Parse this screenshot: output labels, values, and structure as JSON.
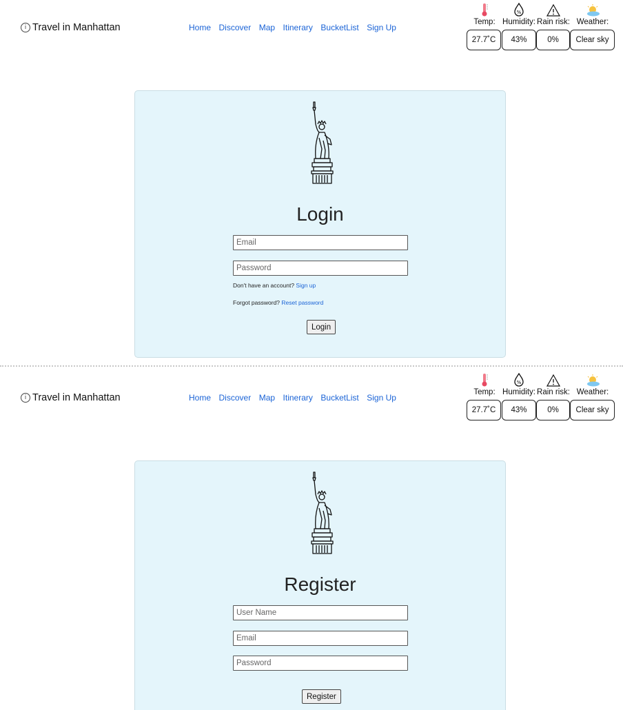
{
  "brand": {
    "icon": "info-icon",
    "text": "Travel in Manhattan",
    "glyph": "i"
  },
  "nav": [
    "Home",
    "Discover",
    "Map",
    "Itinerary",
    "BucketList",
    "Sign Up"
  ],
  "weather": {
    "labels": {
      "temp": "Temp:",
      "humidity": "Humidity:",
      "rain": "Rain risk:",
      "sky": "Weather:"
    },
    "values": {
      "temp": "27.7˚C",
      "humidity": "43%",
      "rain": "0%",
      "sky": "Clear sky"
    },
    "icons": [
      "thermometer-icon",
      "humidity-drop-icon",
      "warning-icon",
      "sun-cloud-icon"
    ]
  },
  "login": {
    "title": "Login",
    "email_placeholder": "Email",
    "password_placeholder": "Password",
    "no_account": "Don't have an account?",
    "signup_link": "Sign up",
    "forgot": "Forgot password?",
    "reset_link": "Reset password",
    "button": "Login"
  },
  "register": {
    "title": "Register",
    "username_placeholder": "User Name",
    "email_placeholder": "Email",
    "password_placeholder": "Password",
    "button": "Register"
  },
  "colors": {
    "card_bg": "#e4f5fb",
    "link": "#1a63d6"
  }
}
